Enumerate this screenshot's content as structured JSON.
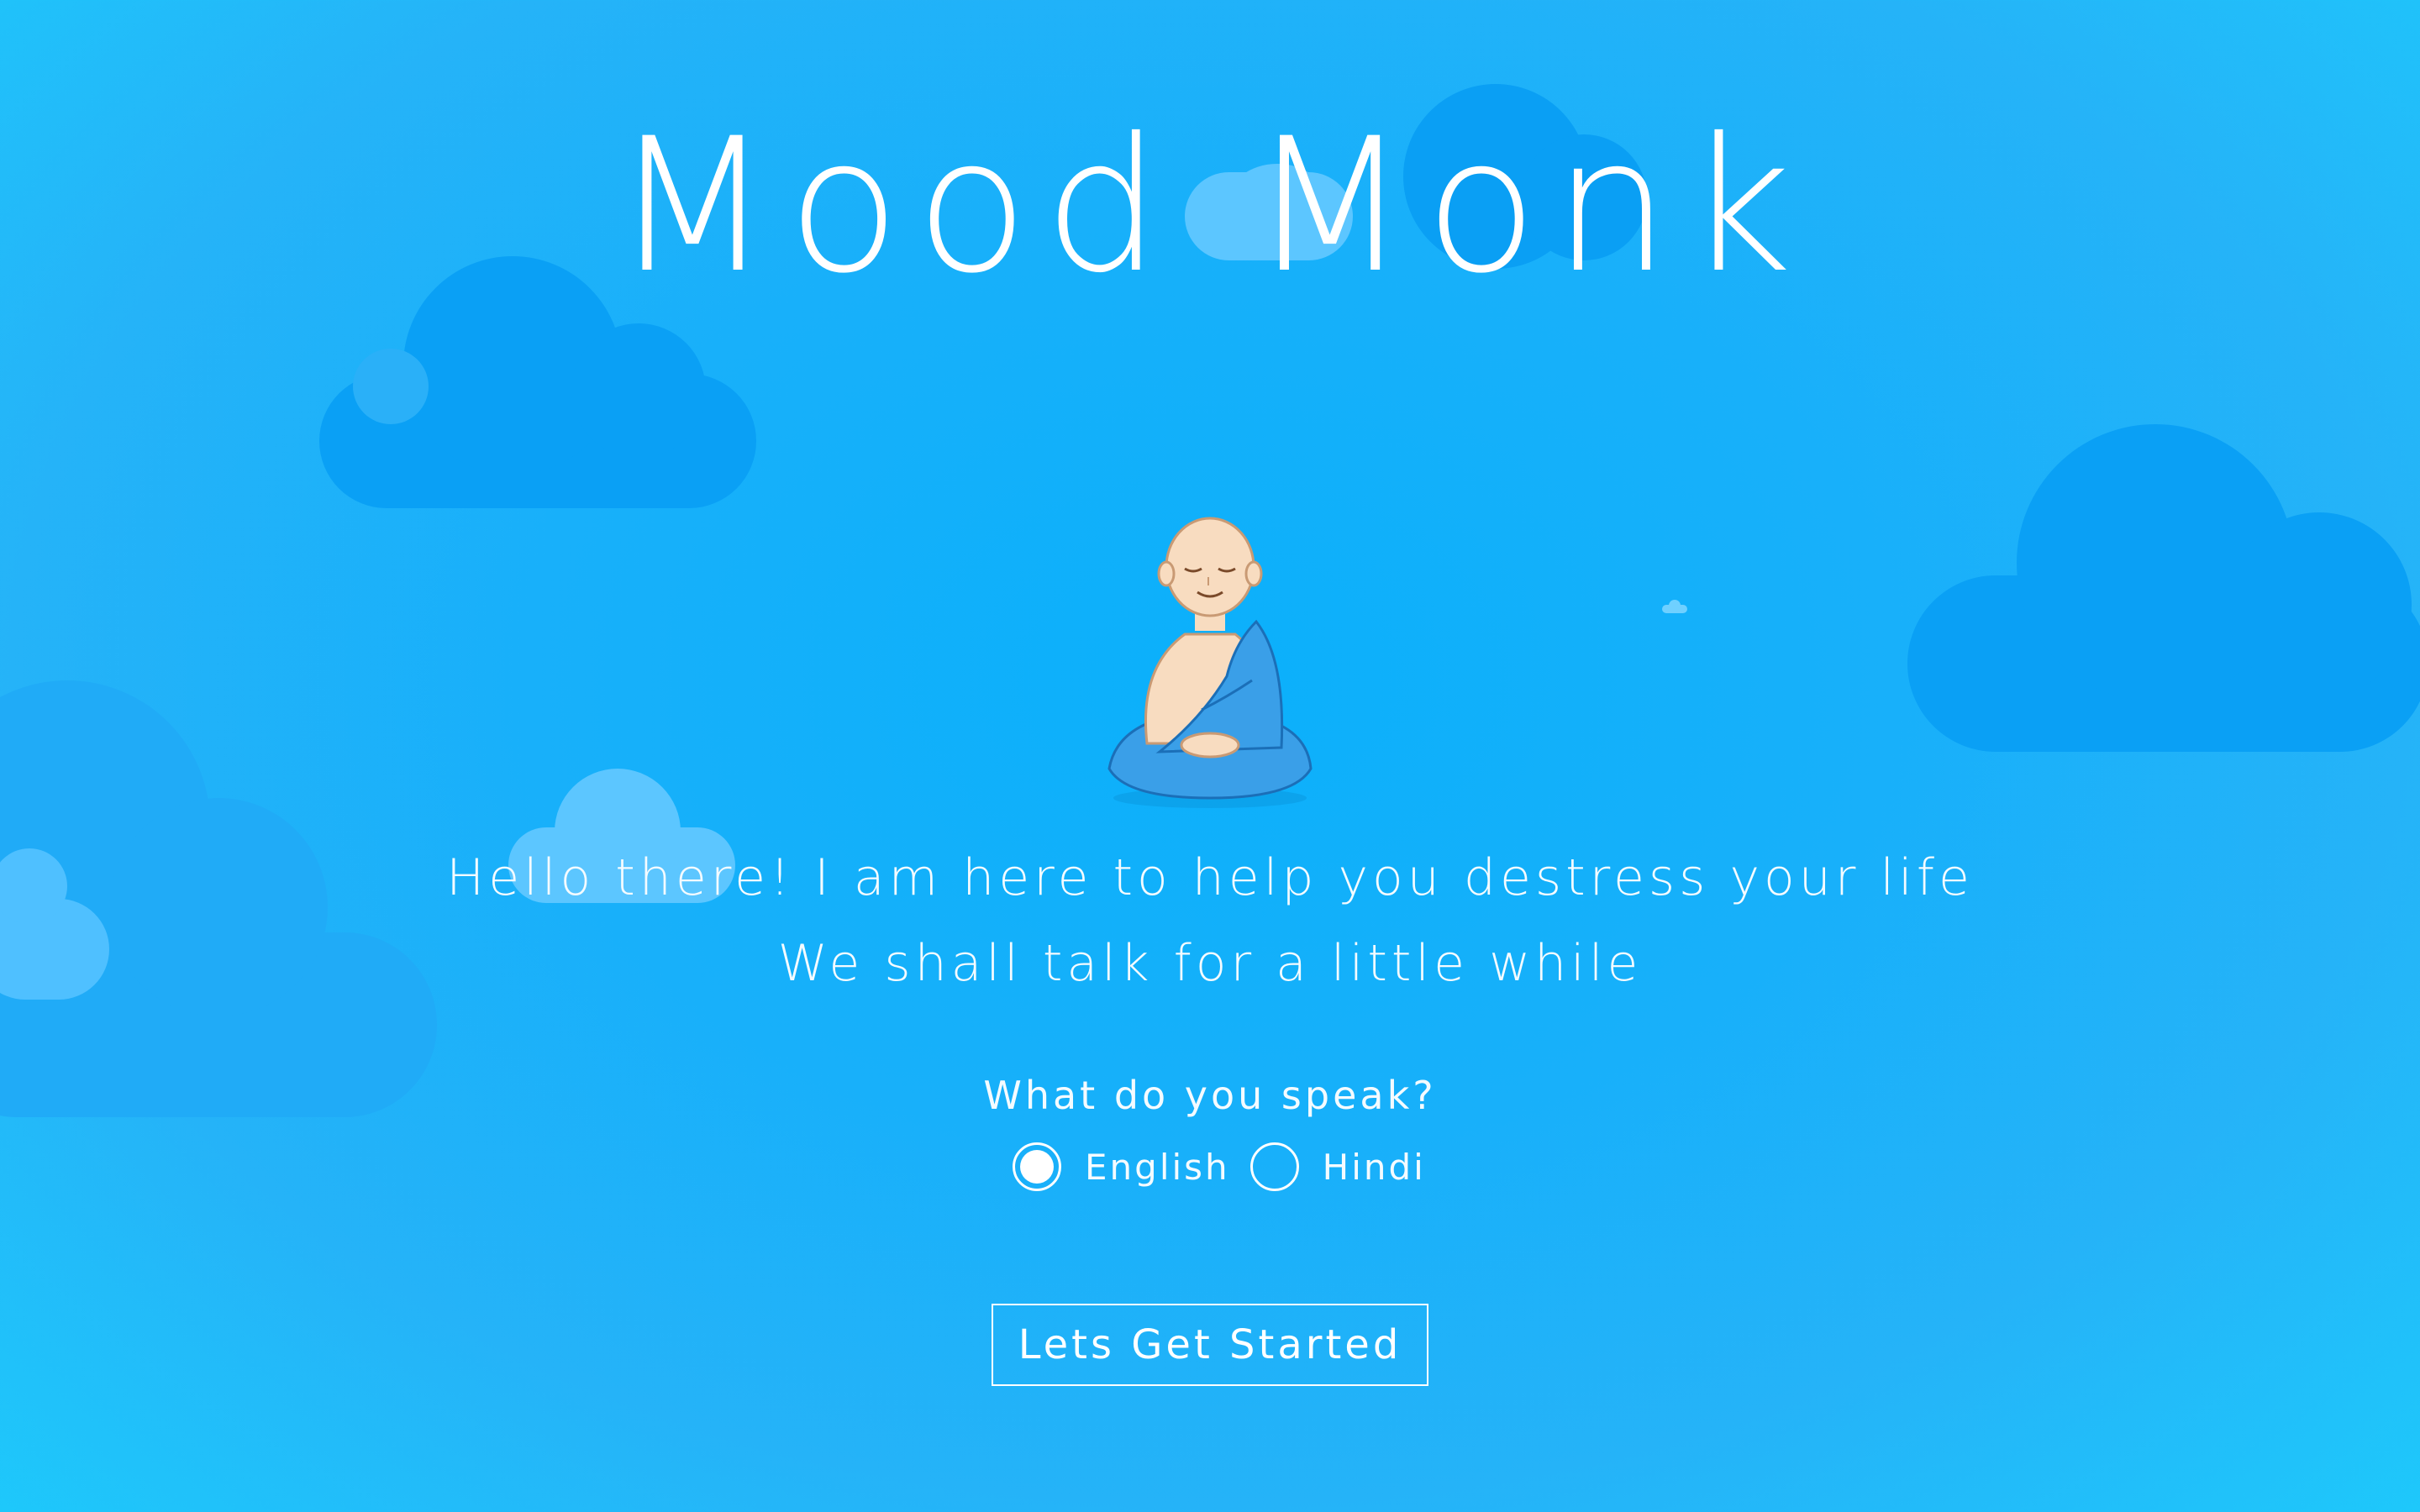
{
  "app": {
    "title": "Mood Monk"
  },
  "intro": {
    "line1": "Hello there! I am here to help you destress your life",
    "line2": "We shall talk for a little while"
  },
  "language": {
    "question": "What do you speak?",
    "options": [
      {
        "label": "English",
        "selected": true
      },
      {
        "label": "Hindi",
        "selected": false
      }
    ]
  },
  "cta": {
    "label": "Lets Get Started"
  },
  "colors": {
    "background": "#18b0fa",
    "cloud_dark": "#0aa0f5",
    "cloud_light": "#5cc6ff",
    "robe": "#3a9fe8",
    "skin": "#f8dcc0",
    "text": "#ffffff"
  },
  "icons": {
    "mascot": "meditating-monk-icon"
  }
}
